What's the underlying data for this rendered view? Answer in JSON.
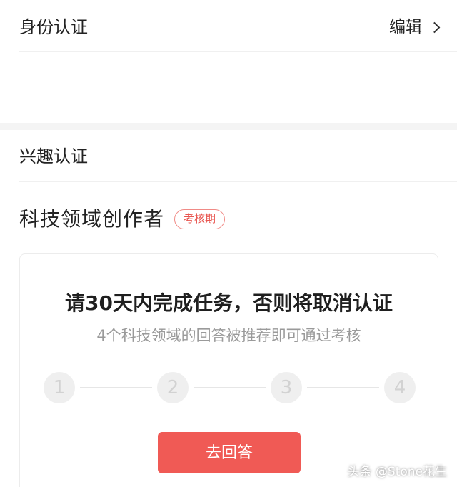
{
  "identity": {
    "title": "身份认证",
    "edit_label": "编辑"
  },
  "interest": {
    "title": "兴趣认证"
  },
  "category": {
    "title": "科技领域创作者",
    "badge": "考核期"
  },
  "task_card": {
    "headline": "请30天内完成任务，否则将取消认证",
    "subline": "4个科技领域的回答被推荐即可通过考核",
    "steps": [
      "1",
      "2",
      "3",
      "4"
    ],
    "button_label": "去回答"
  },
  "watermark": "头条 @Stone花生",
  "colors": {
    "accent": "#f05a55",
    "badge_text": "#e8554f",
    "step_bg": "#efefef"
  }
}
